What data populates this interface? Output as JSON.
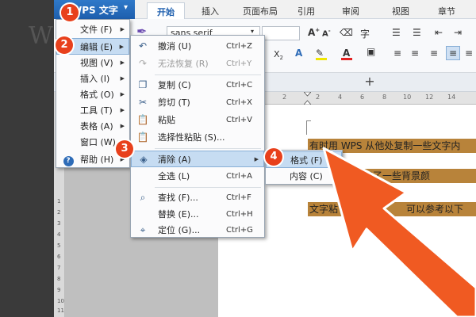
{
  "app": {
    "name": "WPS 文字",
    "ghost_letter": "W"
  },
  "ribbon_tabs": [
    "开始",
    "插入",
    "页面布局",
    "引用",
    "审阅",
    "视图",
    "章节"
  ],
  "ribbon": {
    "font_name": "sans serif"
  },
  "doc_tabbar": {
    "add_label": "+"
  },
  "ruler": {
    "h_numbers": [
      "2",
      "2",
      "4",
      "6",
      "8",
      "10",
      "12",
      "14"
    ],
    "v_numbers": [
      "1",
      "2",
      "3",
      "4",
      "5",
      "6",
      "7",
      "8",
      "9",
      "10",
      "11"
    ]
  },
  "document": {
    "lines": [
      "有时用 WPS 从他处复制一些文字内",
      "却多出了一些背景颜",
      "文字粘",
      "可以参考以下"
    ]
  },
  "main_menu": {
    "items": [
      {
        "label": "文件 (F)",
        "has_sub": true
      },
      {
        "label": "编辑 (E)",
        "has_sub": true,
        "hot": true
      },
      {
        "label": "视图 (V)",
        "has_sub": true
      },
      {
        "label": "插入 (I)",
        "has_sub": true
      },
      {
        "label": "格式 (O)",
        "has_sub": true
      },
      {
        "label": "工具 (T)",
        "has_sub": true
      },
      {
        "label": "表格 (A)",
        "has_sub": true
      },
      {
        "label": "窗口 (W)",
        "has_sub": true
      },
      {
        "label": "帮助 (H)",
        "has_sub": true
      }
    ]
  },
  "edit_menu": {
    "items": [
      {
        "label": "撤消 (U)",
        "shortcut": "Ctrl+Z",
        "icon": "undo-icon"
      },
      {
        "label": "无法恢复 (R)",
        "shortcut": "Ctrl+Y",
        "icon": "redo-icon",
        "disabled": true
      },
      {
        "label": "复制 (C)",
        "shortcut": "Ctrl+C",
        "icon": "copy-icon"
      },
      {
        "label": "剪切 (T)",
        "shortcut": "Ctrl+X",
        "icon": "scissors-icon"
      },
      {
        "label": "粘贴",
        "shortcut": "Ctrl+V",
        "icon": "paste-icon"
      },
      {
        "label": "选择性粘贴 (S)...",
        "shortcut": "",
        "icon": "paste-special-icon"
      },
      {
        "label": "清除 (A)",
        "shortcut": "",
        "icon": "eraser-icon",
        "hot": true,
        "has_sub": true
      },
      {
        "label": "全选 (L)",
        "shortcut": "Ctrl+A",
        "icon": ""
      },
      {
        "label": "查找 (F)...",
        "shortcut": "Ctrl+F",
        "icon": "find-icon"
      },
      {
        "label": "替换 (E)...",
        "shortcut": "Ctrl+H",
        "icon": ""
      },
      {
        "label": "定位 (G)...",
        "shortcut": "Ctrl+G",
        "icon": "goto-icon"
      }
    ]
  },
  "clear_submenu": {
    "items": [
      {
        "label": "格式 (F)",
        "hot": true
      },
      {
        "label": "内容 (C)"
      }
    ]
  },
  "step_badges": [
    "1",
    "2",
    "3",
    "4"
  ],
  "colors": {
    "badge": "#e8401c",
    "app_blue": "#1e5fae",
    "highlight": "#b8833a",
    "arrow": "#f05a22"
  }
}
